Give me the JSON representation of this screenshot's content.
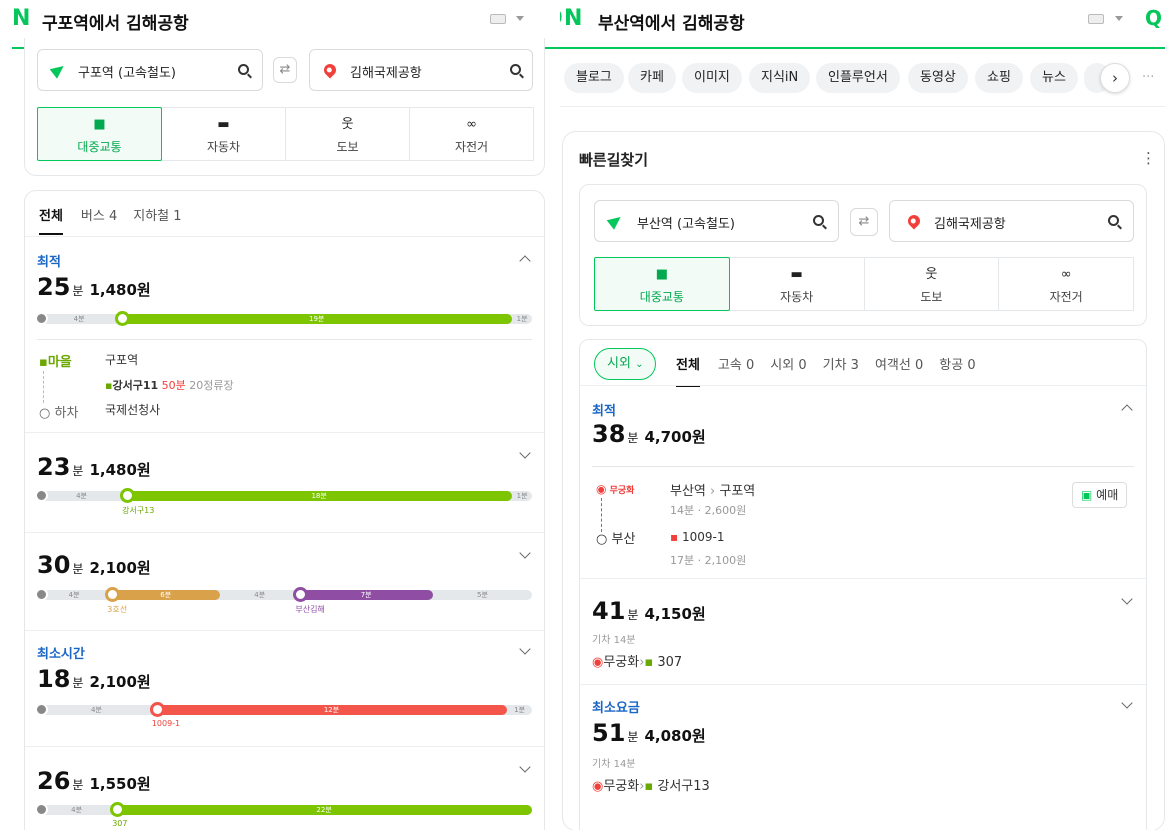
{
  "left": {
    "logo": "N",
    "title": "구포역에서 김해공항",
    "origin": "구포역 (고속철도)",
    "destination": "김해국제공항",
    "swap": "⇄",
    "modes": [
      {
        "label": "대중교통",
        "icon": "■"
      },
      {
        "label": "자동차",
        "icon": "▬"
      },
      {
        "label": "도보",
        "icon": "웃"
      },
      {
        "label": "자전거",
        "icon": "∞"
      }
    ],
    "tabs": [
      {
        "label": "전체"
      },
      {
        "label": "버스",
        "count": "4"
      },
      {
        "label": "지하철",
        "count": "1"
      }
    ],
    "routes": [
      {
        "badge": "최적",
        "time": "25",
        "unit": "분",
        "fare": "1,480원",
        "segments": [
          {
            "color": "#888",
            "fraction": 0.17,
            "label": "4분"
          },
          {
            "color": "#7cc500",
            "fraction": 0.79,
            "label": "19분"
          },
          {
            "color": "#e4e8eb",
            "fraction": 0.04,
            "label": "1분"
          }
        ],
        "detail": {
          "board_tag": "마을",
          "board_stop": "구포역",
          "bus": "강서구11",
          "bus_eta": "50분",
          "bus_stops": "20정류장",
          "alight_tag": "하차",
          "alight_stop": "국제선청사"
        }
      },
      {
        "badge": "",
        "time": "23",
        "unit": "분",
        "fare": "1,480원",
        "segments": [
          {
            "color": "#888",
            "fraction": 0.18,
            "label": "4분"
          },
          {
            "color": "#7cc500",
            "fraction": 0.78,
            "label": "18분"
          },
          {
            "color": "#e4e8eb",
            "fraction": 0.04,
            "label": "1분"
          }
        ],
        "line_labels": [
          {
            "text": "강서구13",
            "color": "#6aa800",
            "at": 0.18
          }
        ]
      },
      {
        "badge": "",
        "time": "30",
        "unit": "분",
        "fare": "2,100원",
        "segments": [
          {
            "color": "#888",
            "fraction": 0.15,
            "label": "4분"
          },
          {
            "color": "#d9a24a",
            "fraction": 0.22,
            "label": "6분"
          },
          {
            "color": "#e4e8eb",
            "fraction": 0.16,
            "label": "4분"
          },
          {
            "color": "#8f4ea3",
            "fraction": 0.27,
            "label": "7분"
          },
          {
            "color": "#e4e8eb",
            "fraction": 0.2,
            "label": "5분"
          }
        ],
        "line_labels": [
          {
            "text": "3호선",
            "color": "#d9a24a",
            "at": 0.15
          },
          {
            "text": "부산김해",
            "color": "#8f4ea3",
            "at": 0.53
          }
        ]
      },
      {
        "badge": "최소시간",
        "time": "18",
        "unit": "분",
        "fare": "2,100원",
        "segments": [
          {
            "color": "#888",
            "fraction": 0.24,
            "label": "4분"
          },
          {
            "color": "#f4554a",
            "fraction": 0.71,
            "label": "12분"
          },
          {
            "color": "#e4e8eb",
            "fraction": 0.05,
            "label": "1분"
          }
        ],
        "line_labels": [
          {
            "text": "1009-1",
            "color": "#f1403b",
            "at": 0.24
          }
        ]
      },
      {
        "badge": "",
        "time": "26",
        "unit": "분",
        "fare": "1,550원",
        "segments": [
          {
            "color": "#888",
            "fraction": 0.16,
            "label": "4분"
          },
          {
            "color": "#7cc500",
            "fraction": 0.84,
            "label": "22분"
          }
        ],
        "line_labels": [
          {
            "text": "307",
            "color": "#6aa800",
            "at": 0.16
          }
        ]
      }
    ]
  },
  "right": {
    "logo": "N",
    "title": "부산역에서 김해공항",
    "chips": [
      "블로그",
      "카페",
      "이미지",
      "지식iN",
      "인플루언서",
      "동영상",
      "쇼핑",
      "뉴스"
    ],
    "more": "···",
    "panel_title": "빠른길찾기",
    "panel_menu": "⋮",
    "origin": "부산역 (고속철도)",
    "destination": "김해국제공항",
    "swap": "⇄",
    "modes": [
      {
        "label": "대중교통",
        "icon": "■"
      },
      {
        "label": "자동차",
        "icon": "▬"
      },
      {
        "label": "도보",
        "icon": "웃"
      },
      {
        "label": "자전거",
        "icon": "∞"
      }
    ],
    "filter": "시외",
    "tabs": [
      {
        "label": "전체"
      },
      {
        "label": "고속",
        "count": "0"
      },
      {
        "label": "시외",
        "count": "0"
      },
      {
        "label": "기차",
        "count": "3"
      },
      {
        "label": "여객선",
        "count": "0"
      },
      {
        "label": "항공",
        "count": "0"
      }
    ],
    "routes": [
      {
        "badge": "최적",
        "time": "38",
        "unit": "분",
        "fare": "4,700원",
        "detail": {
          "train_tag": "무궁화",
          "path_from": "부산역",
          "path_to": "구포역",
          "train_info": "14분 · 2,600원",
          "reserve": "예매",
          "bus_tag": "부산",
          "bus": "1009-1",
          "bus_info": "17분 · 2,100원"
        }
      },
      {
        "badge": "",
        "time": "41",
        "unit": "분",
        "fare": "4,150원",
        "sub": "기차 14분",
        "train": "무궁화",
        "bus": "307"
      },
      {
        "badge": "최소요금",
        "time": "51",
        "unit": "분",
        "fare": "4,080원",
        "sub": "기차 14분",
        "train": "무궁화",
        "bus": "강서구13"
      }
    ]
  }
}
